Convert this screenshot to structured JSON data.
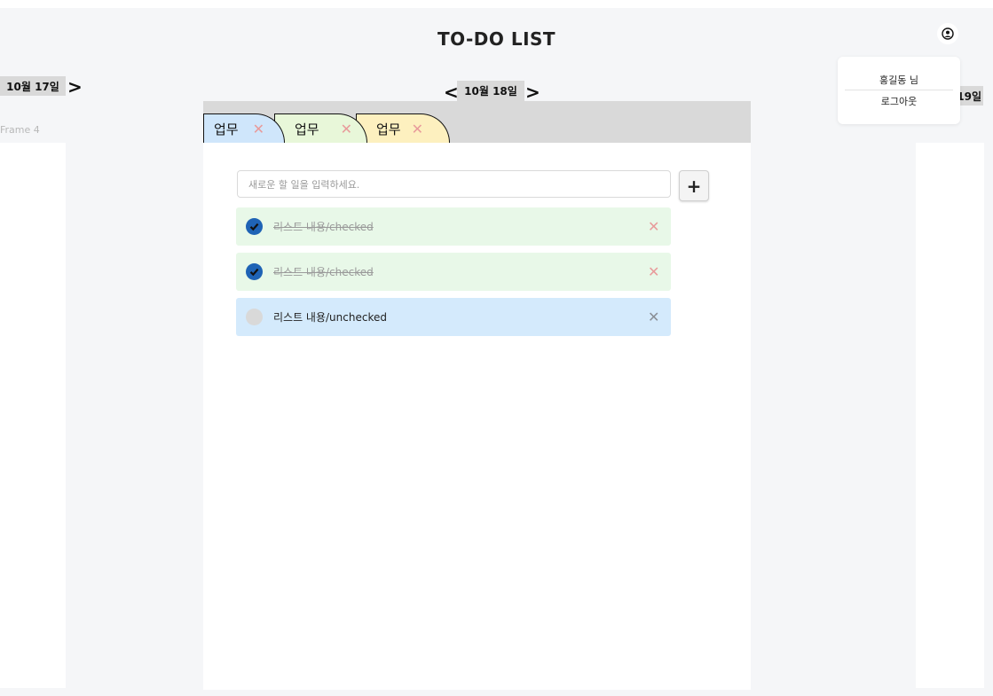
{
  "header": {
    "title": "TO-DO LIST",
    "profile_icon": "user-circle-icon"
  },
  "user_menu": {
    "username": "홍길동 님",
    "logout": "로그아웃"
  },
  "frame_label": "Frame 4",
  "dates": {
    "prev": "10월 17일",
    "current": "10월 18일",
    "next": "10월 19일",
    "prev_arrow": "<",
    "next_arrow": ">"
  },
  "tabs": [
    {
      "label": "업무",
      "close": "✕",
      "color": "#cfe6fb"
    },
    {
      "label": "업무",
      "close": "✕",
      "color": "#e8f7d9"
    },
    {
      "label": "업무",
      "close": "✕",
      "color": "#fdf0bf"
    }
  ],
  "input": {
    "placeholder": "새로운 할 일을 입력하세요.",
    "add_label": "+"
  },
  "todos": [
    {
      "text": "리스트 내용/checked",
      "checked": true,
      "delete": "✕",
      "bg": "#e8f8e8",
      "delete_color": "#e89b9b"
    },
    {
      "text": "리스트 내용/checked",
      "checked": true,
      "delete": "✕",
      "bg": "#e8f8e8",
      "delete_color": "#e89b9b"
    },
    {
      "text": "리스트 내용/unchecked",
      "checked": false,
      "delete": "✕",
      "bg": "#d4eafc",
      "delete_color": "#8a8f96"
    }
  ]
}
